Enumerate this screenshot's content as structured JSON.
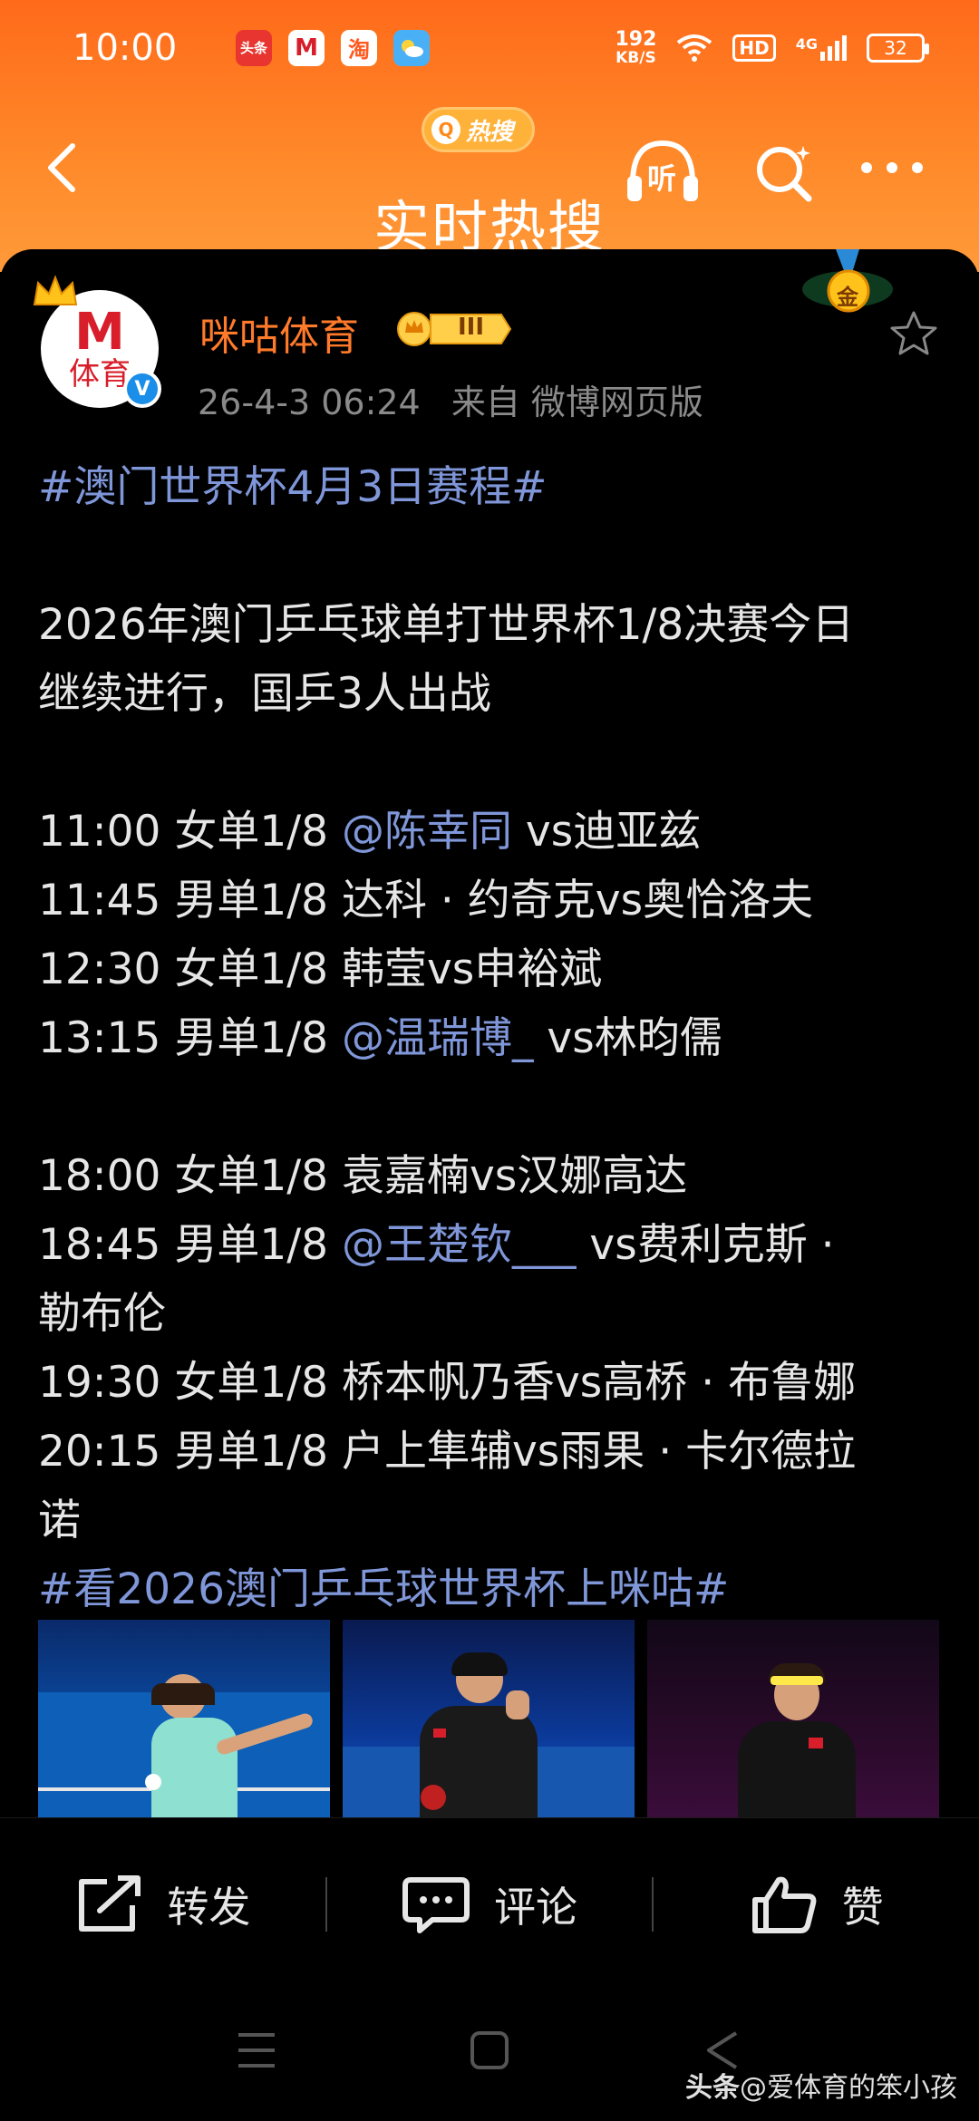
{
  "status_bar": {
    "time": "10:00",
    "apps": [
      {
        "icon": "toutiao-app-icon",
        "text": "头条",
        "color": "#e8352f"
      },
      {
        "icon": "migu-app-icon",
        "text": "M",
        "color": "#ffffff"
      },
      {
        "icon": "taobao-app-icon",
        "text": "淘",
        "color": "#ff5a1f"
      },
      {
        "icon": "weather-app-icon",
        "text": "",
        "color": "#4ab0f5"
      }
    ],
    "net_speed_value": "192",
    "net_speed_unit": "KB/S",
    "hd": "HD",
    "network": "4G",
    "battery": "32"
  },
  "header": {
    "hot_badge": "热搜",
    "title": "实时热搜",
    "listen_label": "听"
  },
  "post": {
    "author": "咪咕体育",
    "vip_level": "III",
    "avatar_top": "M",
    "avatar_bottom": "体育",
    "verified_mark": "V",
    "medal_label": "金",
    "timestamp": "26-4-3 06:24",
    "source": "来自 微博网页版",
    "lines": [
      [
        {
          "t": "#澳门世界杯4月3日赛程#",
          "k": "topic"
        }
      ],
      [],
      [
        {
          "t": "2026年澳门乒乓球单打世界杯1/8决赛今日",
          "k": "text"
        }
      ],
      [
        {
          "t": "继续进行，国乒3人出战",
          "k": "text"
        }
      ],
      [],
      [
        {
          "t": "11:00 女单1/8 ",
          "k": "text"
        },
        {
          "t": "@陈幸同",
          "k": "mention"
        },
        {
          "t": " vs迪亚兹",
          "k": "text"
        }
      ],
      [
        {
          "t": "11:45 男单1/8 达科 · 约奇克vs奥恰洛夫",
          "k": "text"
        }
      ],
      [
        {
          "t": "12:30 女单1/8 韩莹vs申裕斌",
          "k": "text"
        }
      ],
      [
        {
          "t": "13:15 男单1/8 ",
          "k": "text"
        },
        {
          "t": "@温瑞博_",
          "k": "mention"
        },
        {
          "t": " vs林昀儒",
          "k": "text"
        }
      ],
      [],
      [
        {
          "t": "18:00 女单1/8 袁嘉楠vs汉娜高达",
          "k": "text"
        }
      ],
      [
        {
          "t": "18:45 男单1/8 ",
          "k": "text"
        },
        {
          "t": "@王楚钦___",
          "k": "mention"
        },
        {
          "t": " vs费利克斯 ·",
          "k": "text"
        }
      ],
      [
        {
          "t": "勒布伦",
          "k": "text"
        }
      ],
      [
        {
          "t": "19:30 女单1/8 桥本帆乃香vs高桥 · 布鲁娜",
          "k": "text"
        }
      ],
      [
        {
          "t": "20:15 男单1/8 户上隼辅vs雨果 · 卡尔德拉",
          "k": "text"
        }
      ],
      [
        {
          "t": "诺",
          "k": "text"
        }
      ],
      [
        {
          "t": "#看2026澳门乒乓球世界杯上咪咕#",
          "k": "topic"
        }
      ]
    ],
    "images": [
      "player-photo-1",
      "player-photo-2",
      "player-photo-3"
    ]
  },
  "actions": {
    "repost": "转发",
    "comment": "评论",
    "like": "赞"
  },
  "watermark": {
    "brand": "头条",
    "author": "@爱体育的笨小孩"
  },
  "colors": {
    "accent": "#ff7a2a",
    "link": "#7f96d8",
    "header_top": "#ff6a1a",
    "header_bottom": "#ff9a3a"
  }
}
